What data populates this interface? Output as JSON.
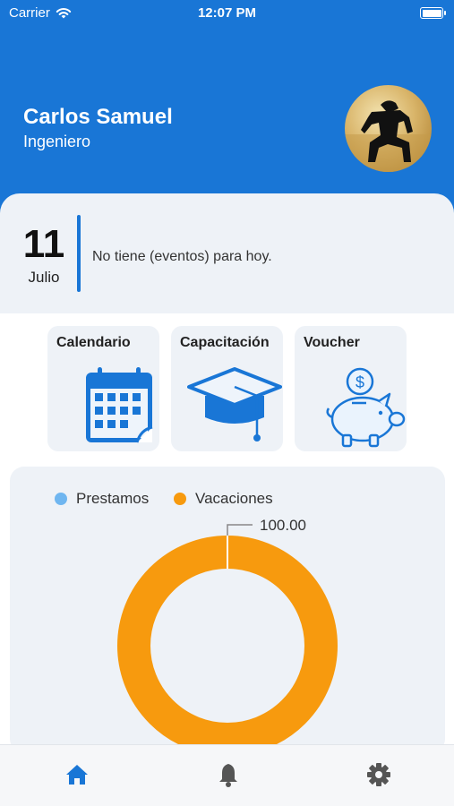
{
  "status_bar": {
    "carrier": "Carrier",
    "time": "12:07 PM"
  },
  "user": {
    "name": "Carlos Samuel",
    "role": "Ingeniero"
  },
  "today": {
    "day": "11",
    "month": "Julio",
    "events_text": "No tiene (eventos) para hoy."
  },
  "menu": [
    {
      "label": "Calendario",
      "icon": "calendar-icon"
    },
    {
      "label": "Capacitación",
      "icon": "graduation-cap-icon"
    },
    {
      "label": "Voucher",
      "icon": "piggy-bank-icon"
    }
  ],
  "chart_data": {
    "type": "pie",
    "series": [
      {
        "name": "Prestamos",
        "value": 0,
        "color": "#6fb6f0"
      },
      {
        "name": "Vacaciones",
        "value": 100.0,
        "color": "#f79a0e"
      }
    ],
    "data_label": "100.00",
    "legend_position": "top"
  },
  "nav": [
    {
      "icon": "home-icon",
      "active": true,
      "color": "#1976d6"
    },
    {
      "icon": "bell-icon",
      "active": false,
      "color": "#555555"
    },
    {
      "icon": "settings-icon",
      "active": false,
      "color": "#555555"
    }
  ]
}
